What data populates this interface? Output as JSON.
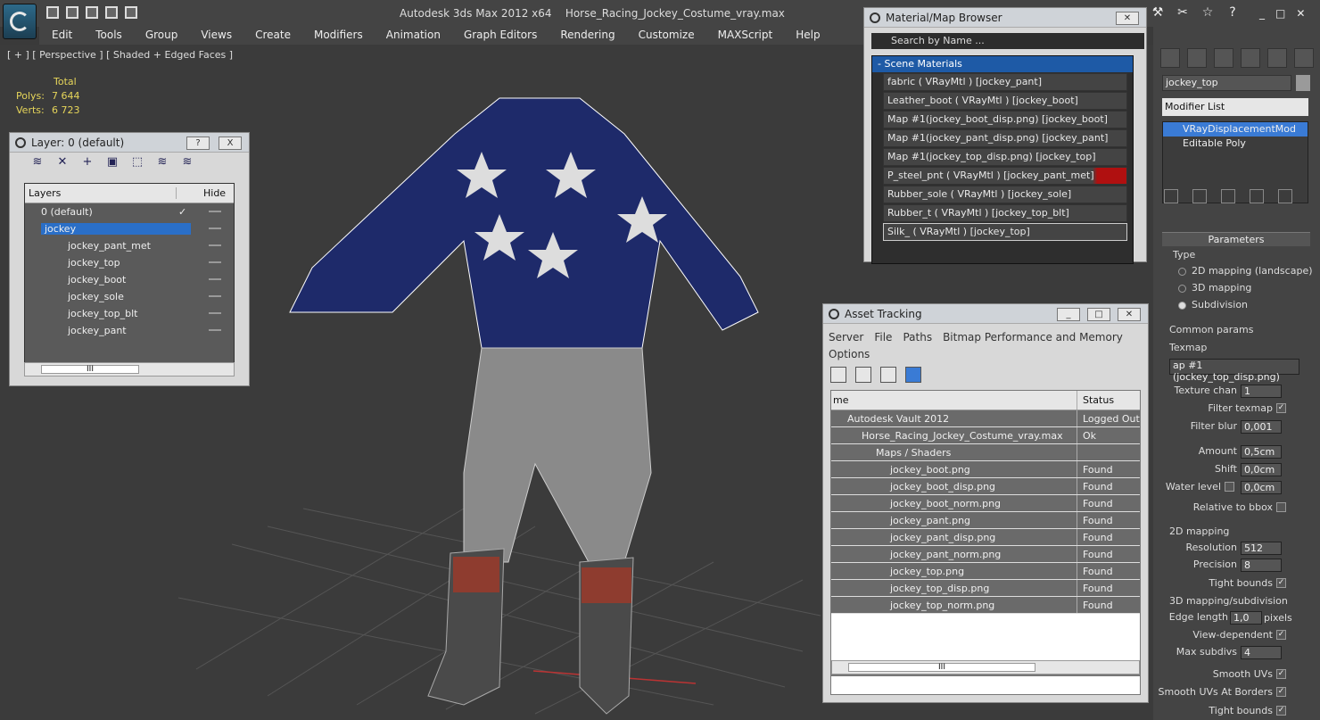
{
  "app": {
    "title": "Autodesk 3ds Max  2012 x64",
    "file": "Horse_Racing_Jockey_Costume_vray.max"
  },
  "menu": [
    "Edit",
    "Tools",
    "Group",
    "Views",
    "Create",
    "Modifiers",
    "Animation",
    "Graph Editors",
    "Rendering",
    "Customize",
    "MAXScript",
    "Help"
  ],
  "viewport": {
    "label": "[ + ] [ Perspective ] [ Shaded + Edged Faces ]",
    "stats_header": "Total",
    "polys_label": "Polys:",
    "polys": "7 644",
    "verts_label": "Verts:",
    "verts": "6 723"
  },
  "layers": {
    "title": "Layer: 0 (default)",
    "help": "?",
    "close": "X",
    "col_layers": "Layers",
    "col_hide": "Hide",
    "scroll_label": "III",
    "items": [
      "0 (default)",
      "jockey",
      "jockey_pant_met",
      "jockey_top",
      "jockey_boot",
      "jockey_sole",
      "jockey_top_blt",
      "jockey_pant"
    ]
  },
  "material_browser": {
    "title": "Material/Map Browser",
    "search": "Search by Name ...",
    "section": "- Scene Materials",
    "items": [
      "fabric  ( VRayMtl ) [jockey_pant]",
      "Leather_boot  ( VRayMtl ) [jockey_boot]",
      "Map #1(jockey_boot_disp.png) [jockey_boot]",
      "Map #1(jockey_pant_disp.png) [jockey_pant]",
      "Map #1(jockey_top_disp.png) [jockey_top]",
      "P_steel_pnt  ( VRayMtl ) [jockey_pant_met]",
      "Rubber_sole  ( VRayMtl ) [jockey_sole]",
      "Rubber_t  ( VRayMtl ) [jockey_top_blt]",
      "Silk_  ( VRayMtl ) [jockey_top]"
    ]
  },
  "asset_tracking": {
    "title": "Asset Tracking",
    "menu1": [
      "Server",
      "File",
      "Paths",
      "Bitmap Performance and Memory"
    ],
    "menu2": "Options",
    "col_name": "me",
    "col_status": "Status",
    "scroll_label": "III",
    "rows": [
      {
        "name": "Autodesk Vault 2012",
        "status": "Logged Out",
        "indent": 0
      },
      {
        "name": "Horse_Racing_Jockey_Costume_vray.max",
        "status": "Ok",
        "indent": 1
      },
      {
        "name": "Maps / Shaders",
        "status": "",
        "indent": 2
      },
      {
        "name": "jockey_boot.png",
        "status": "Found",
        "indent": 3
      },
      {
        "name": "jockey_boot_disp.png",
        "status": "Found",
        "indent": 3
      },
      {
        "name": "jockey_boot_norm.png",
        "status": "Found",
        "indent": 3
      },
      {
        "name": "jockey_pant.png",
        "status": "Found",
        "indent": 3
      },
      {
        "name": "jockey_pant_disp.png",
        "status": "Found",
        "indent": 3
      },
      {
        "name": "jockey_pant_norm.png",
        "status": "Found",
        "indent": 3
      },
      {
        "name": "jockey_top.png",
        "status": "Found",
        "indent": 3
      },
      {
        "name": "jockey_top_disp.png",
        "status": "Found",
        "indent": 3
      },
      {
        "name": "jockey_top_norm.png",
        "status": "Found",
        "indent": 3
      }
    ]
  },
  "command_panel": {
    "object_name": "jockey_top",
    "modifier_list": "Modifier List",
    "stack": [
      "VRayDisplacementMod",
      "Editable Poly"
    ],
    "parameters": "Parameters",
    "type": "Type",
    "type_opts": [
      "2D mapping (landscape)",
      "3D mapping",
      "Subdivision"
    ],
    "common": "Common params",
    "texmap": "Texmap",
    "texmap_val": "ap #1 (jockey_top_disp.png)",
    "texture_chan_label": "Texture chan",
    "texture_chan": "1",
    "filter_texmap": "Filter texmap",
    "filter_blur_label": "Filter blur",
    "filter_blur": "0,001",
    "amount_label": "Amount",
    "amount": "0,5cm",
    "shift_label": "Shift",
    "shift": "0,0cm",
    "water_label": "Water level",
    "water": "0,0cm",
    "relative": "Relative to bbox",
    "map2d": "2D mapping",
    "res_label": "Resolution",
    "res": "512",
    "prec_label": "Precision",
    "prec": "8",
    "tight1": "Tight bounds",
    "map3d": "3D mapping/subdivision",
    "edge_label": "Edge length",
    "edge": "1,0",
    "pixels": "pixels",
    "view_dep": "View-dependent",
    "max_label": "Max subdivs",
    "max": "4",
    "smooth_uv": "Smooth UVs",
    "smooth_uv_b": "Smooth UVs At Borders",
    "tight2": "Tight bounds"
  }
}
